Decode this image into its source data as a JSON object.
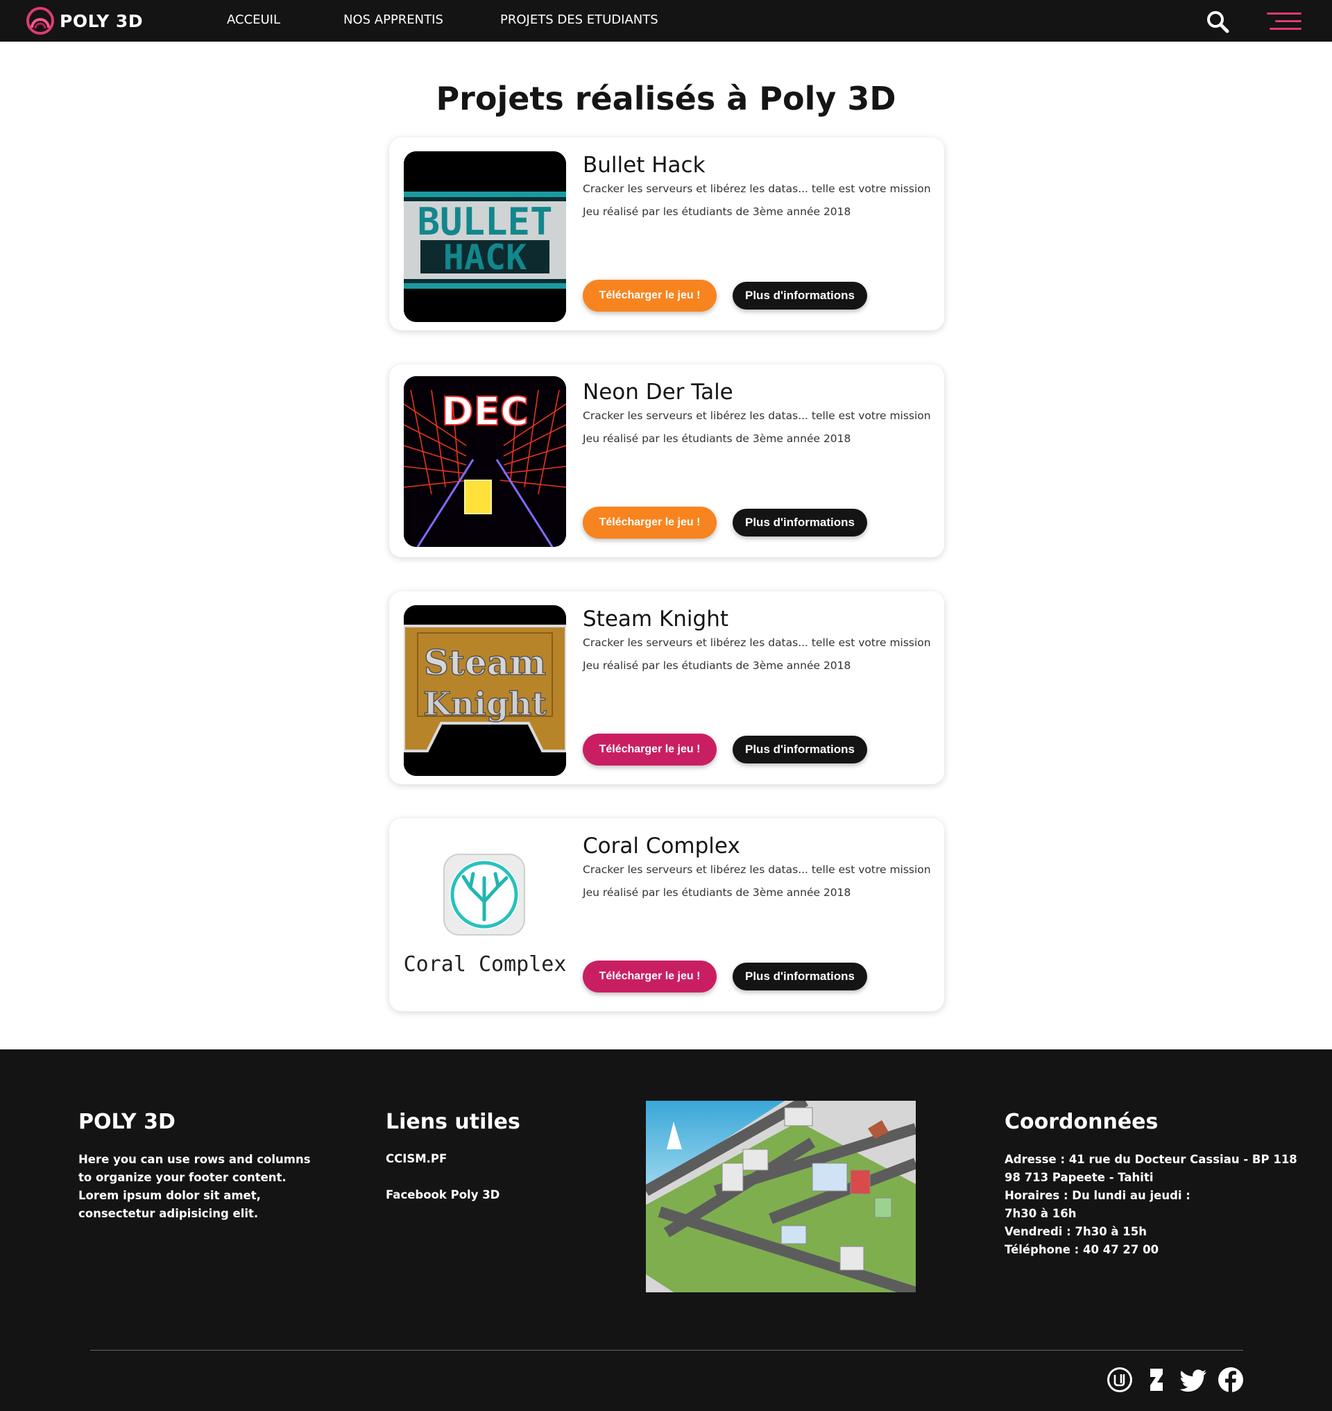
{
  "nav": {
    "brand": "POLY 3D",
    "links": [
      "ACCEUIL",
      "NOS APPRENTIS",
      "PROJETS DES ETUDIANTS"
    ],
    "search_icon": "search-icon",
    "menu_icon": "hamburger-menu-icon",
    "accent_color": "#e13a73"
  },
  "page": {
    "title": "Projets réalisés à Poly 3D"
  },
  "projects": [
    {
      "title": "Bullet Hack",
      "image_text": [
        "BULLET",
        "HACK"
      ],
      "description": "Cracker les serveurs et libérez les datas... telle est votre mission",
      "credit": "Jeu réalisé par les étudiants de 3ème année 2018",
      "download_label": "Télécharger le jeu !",
      "info_label": "Plus d'informations",
      "button_color": "#f7841f"
    },
    {
      "title": "Neon Der Tale",
      "image_text": [
        "DEC"
      ],
      "description": "Cracker les serveurs et libérez les datas... telle est votre mission",
      "credit": "Jeu réalisé par les étudiants de 3ème année 2018",
      "download_label": "Télécharger le jeu !",
      "info_label": "Plus d'informations",
      "button_color": "#f7841f"
    },
    {
      "title": "Steam Knight",
      "image_text": [
        "Steam",
        "Knight"
      ],
      "description": "Cracker les serveurs et libérez les datas... telle est votre mission",
      "credit": "Jeu réalisé par les étudiants de 3ème année 2018",
      "download_label": "Télécharger le jeu !",
      "info_label": "Plus d'informations",
      "button_color": "#c91f62"
    },
    {
      "title": "Coral Complex",
      "image_text": [
        "Coral Complex"
      ],
      "description": "Cracker les serveurs et libérez les datas... telle est votre mission",
      "credit": "Jeu réalisé par les étudiants de 3ème année 2018",
      "download_label": "Télécharger le jeu !",
      "info_label": "Plus d'informations",
      "button_color": "#c91f62"
    }
  ],
  "footer": {
    "about_title": "POLY 3D",
    "about_lines": [
      "Here you can use rows and columns",
      "to organize your footer content.",
      "Lorem ipsum dolor sit amet,",
      "consectetur adipisicing elit."
    ],
    "links_title": "Liens utiles",
    "links": [
      "CCISM.PF",
      "Facebook Poly 3D"
    ],
    "contact_title": "Coordonnées",
    "contact_lines": [
      "Adresse : 41 rue du Docteur Cassiau - BP 118",
      "98 713 Papeete - Tahiti",
      "Horaires : Du lundi au jeudi :",
      "7h30 à 16h",
      "Vendredi : 7h30 à 15h",
      "Téléphone : 40 47 27 00"
    ],
    "social_icons": [
      "unreal-engine-icon",
      "deviantart-icon",
      "twitter-icon",
      "facebook-icon"
    ]
  }
}
